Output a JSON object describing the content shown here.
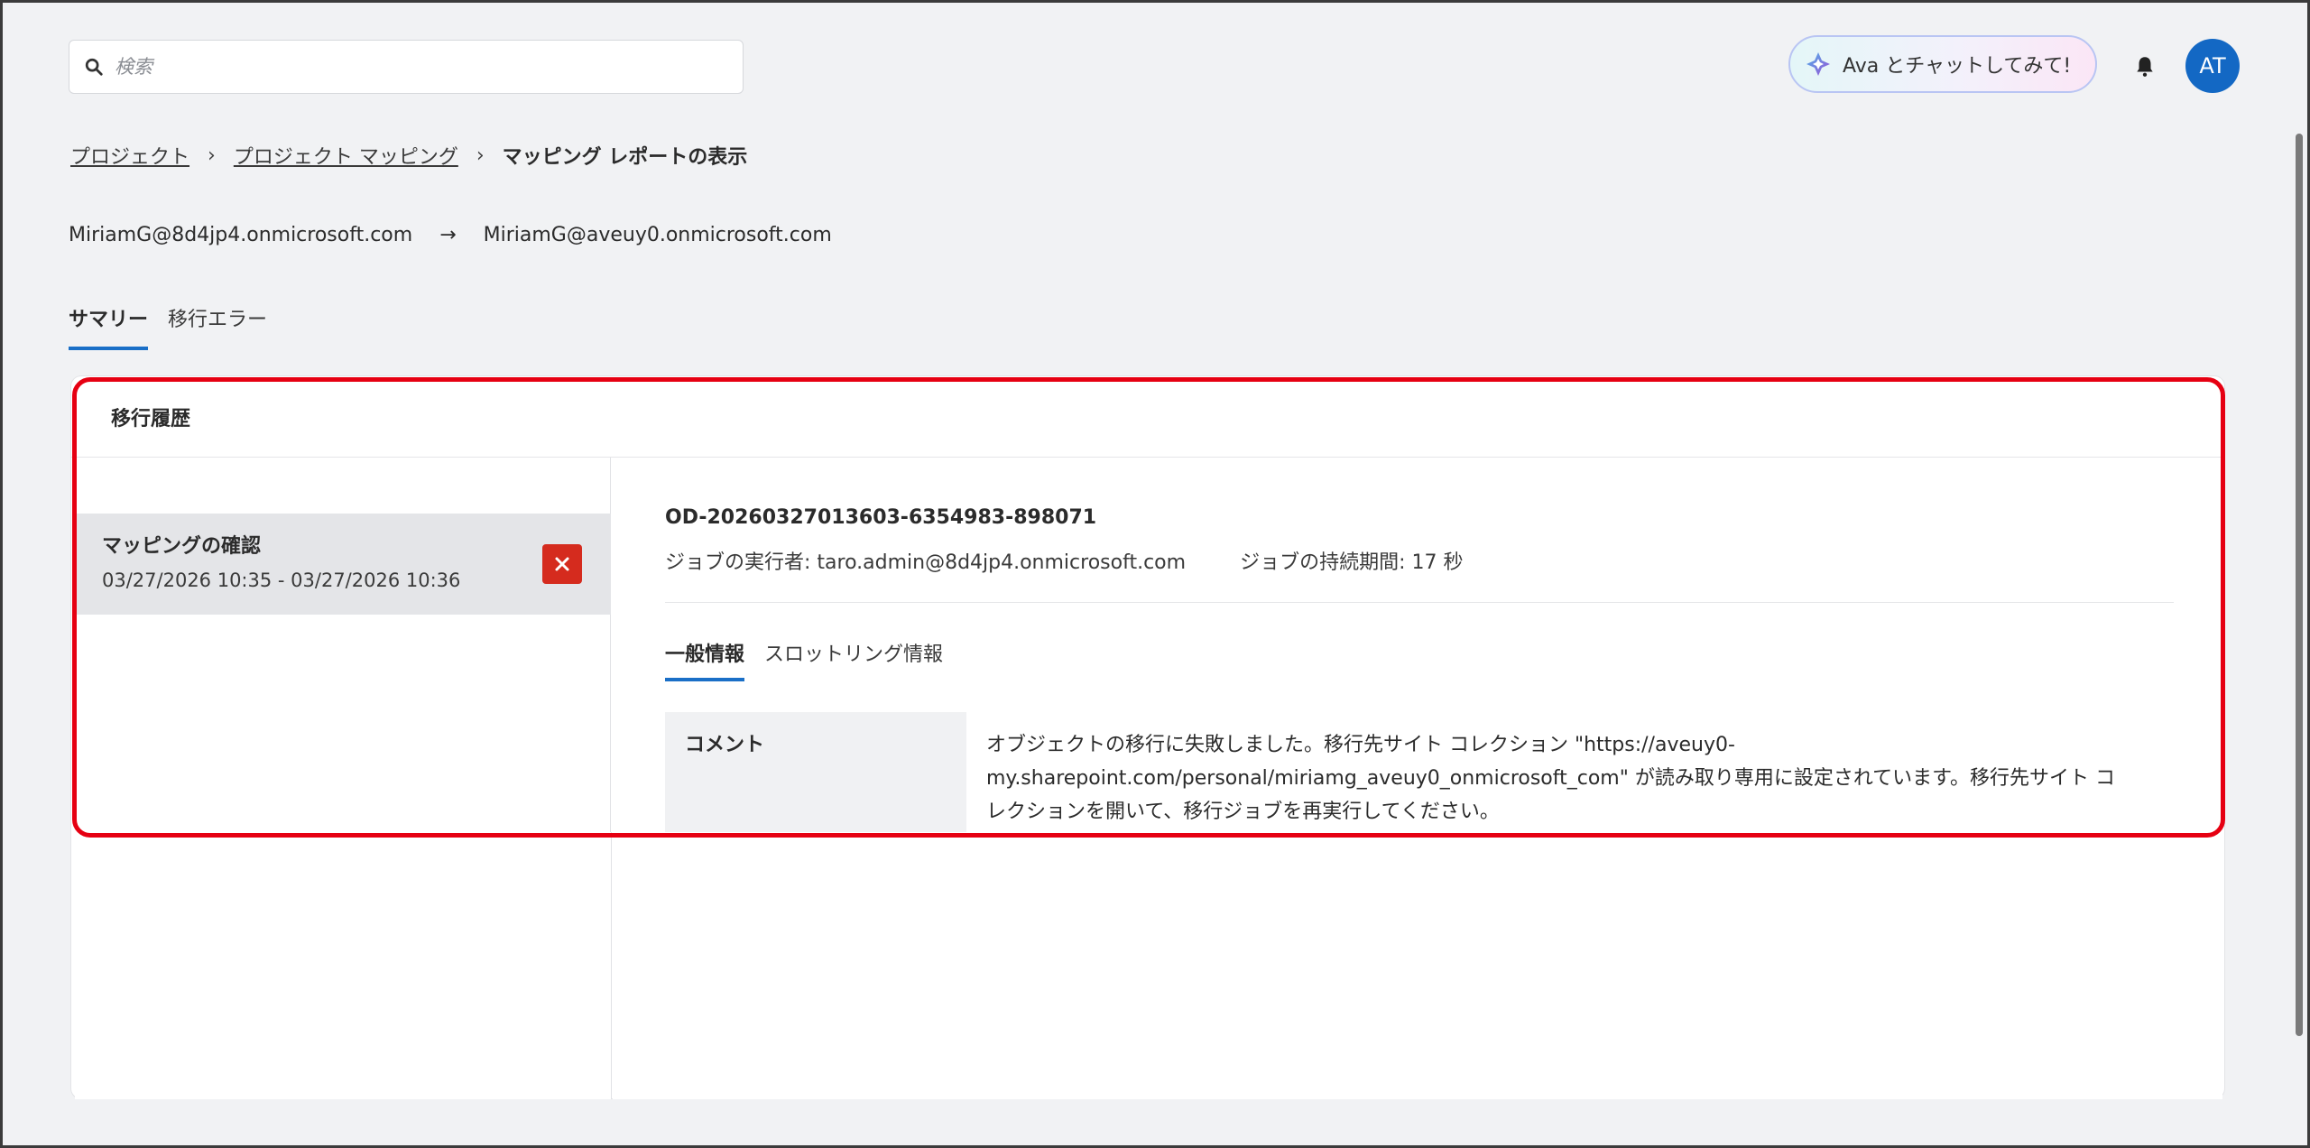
{
  "header": {
    "search_placeholder": "検索",
    "ava_label": "Ava とチャットしてみて!",
    "avatar_initials": "AT"
  },
  "breadcrumb": {
    "items": [
      "プロジェクト",
      "プロジェクト マッピング"
    ],
    "current": "マッピング レポートの表示"
  },
  "mapping": {
    "source": "MiriamG@8d4jp4.onmicrosoft.com",
    "arrow": "→",
    "destination": "MiriamG@aveuy0.onmicrosoft.com"
  },
  "tabs": [
    {
      "label": "サマリー",
      "active": true
    },
    {
      "label": "移行エラー",
      "active": false
    }
  ],
  "card": {
    "title": "移行履歴",
    "history": [
      {
        "title": "マッピングの確認",
        "date_range": "03/27/2026 10:35 - 03/27/2026 10:36",
        "status": "failed"
      }
    ],
    "job": {
      "id": "OD-20260327013603-6354983-898071",
      "runner": "ジョブの実行者: taro.admin@8d4jp4.onmicrosoft.com",
      "duration": "ジョブの持続期間: 17 秒"
    },
    "sub_tabs": [
      {
        "label": "一般情報",
        "active": true
      },
      {
        "label": "スロットリング情報",
        "active": false
      }
    ],
    "info": {
      "label": "コメント",
      "value": "オブジェクトの移行に失敗しました。移行先サイト コレクション \"https://aveuy0-my.sharepoint.com/personal/miriamg_aveuy0_onmicrosoft_com\" が読み取り専用に設定されています。移行先サイト コレクションを開いて、移行ジョブを再実行してください。"
    }
  },
  "colors": {
    "accent": "#1a6fc7",
    "avatar": "#1368c4",
    "error": "#d52b1e",
    "highlight": "#e60012"
  }
}
